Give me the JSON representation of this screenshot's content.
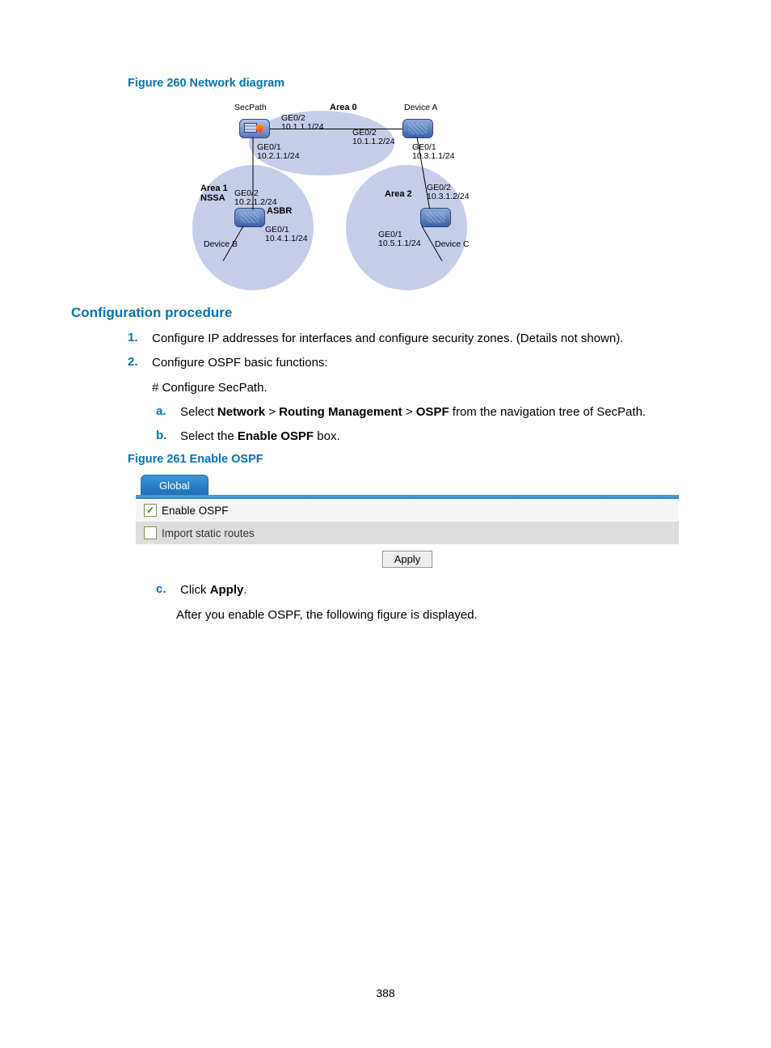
{
  "figure260": {
    "caption": "Figure 260 Network diagram",
    "area0": "Area 0",
    "area1_line1": "Area 1",
    "area1_line2": "NSSA",
    "area2": "Area 2",
    "secpath_label": "SecPath",
    "deviceA": "Device A",
    "deviceB": "Device B",
    "deviceC": "Device C",
    "asbr": "ASBR",
    "secpath_ge02": "GE0/2\n10.1.1.1/24",
    "secpath_ge01": "GE0/1\n10.2.1.1/24",
    "devA_ge02": "GE0/2\n10.1.1.2/24",
    "devA_ge01": "GE0/1\n10.3.1.1/24",
    "devB_ge02": "GE0/2\n10.2.1.2/24",
    "devB_ge01": "GE0/1\n10.4.1.1/24",
    "devC_ge02": "GE0/2\n10.3.1.2/24",
    "devC_ge01": "GE0/1\n10.5.1.1/24"
  },
  "heading_config": "Configuration procedure",
  "steps": {
    "n1": "1.",
    "t1": "Configure IP addresses for interfaces and configure security zones. (Details not shown).",
    "n2": "2.",
    "t2": "Configure OSPF basic functions:",
    "t2a": "# Configure SecPath.",
    "sa": "a.",
    "sa_pre": "Select ",
    "sa_b1": "Network",
    "sa_gt1": " > ",
    "sa_b2": "Routing Management",
    "sa_gt2": " > ",
    "sa_b3": "OSPF",
    "sa_post": " from the navigation tree of SecPath.",
    "sb": "b.",
    "sb_pre": "Select the ",
    "sb_b1": "Enable OSPF",
    "sb_post": " box.",
    "sc": "c.",
    "sc_pre": "Click ",
    "sc_b1": "Apply",
    "sc_post": ".",
    "sc_after": "After you enable OSPF, the following figure is displayed."
  },
  "figure261": {
    "caption": "Figure 261 Enable OSPF",
    "tab_global": "Global",
    "enable_ospf": "Enable OSPF",
    "import_static": "Import static routes",
    "apply": "Apply"
  },
  "page_number": "388"
}
